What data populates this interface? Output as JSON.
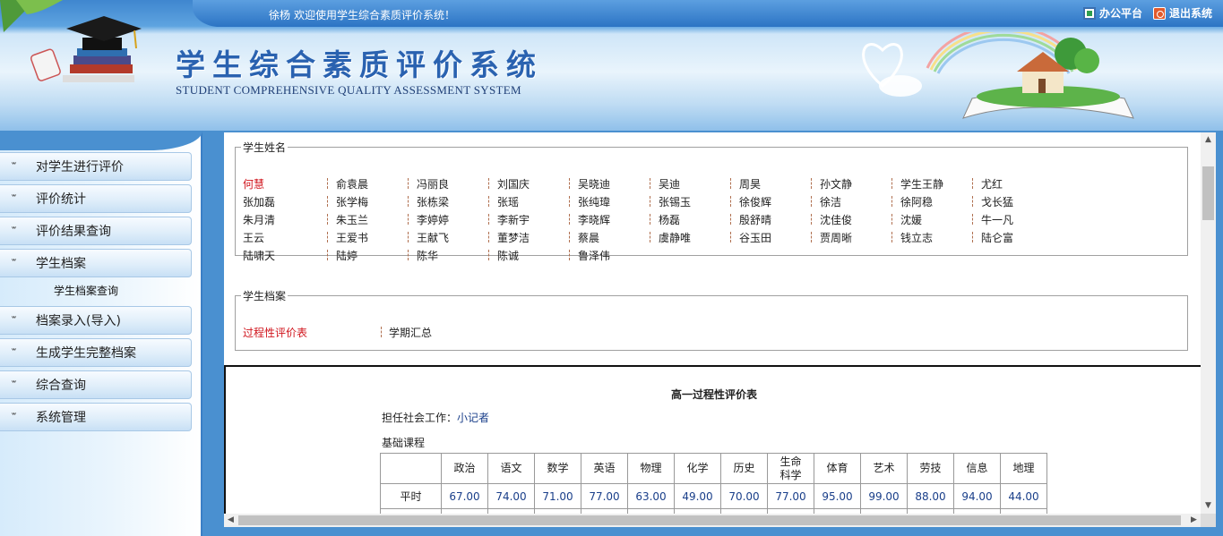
{
  "header": {
    "welcome_user": "徐杨",
    "welcome_text": "欢迎使用学生综合素质评价系统！",
    "office_link": "办公平台",
    "logout_link": "退出系统",
    "title": "学生综合素质评价系统",
    "subtitle": "STUDENT COMPREHENSIVE QUALITY ASSESSMENT SYSTEM"
  },
  "sidebar": {
    "items": [
      {
        "label": "对学生进行评价"
      },
      {
        "label": "评价统计"
      },
      {
        "label": "评价结果查询"
      },
      {
        "label": "学生档案"
      },
      {
        "label": "档案录入(导入)"
      },
      {
        "label": "生成学生完整档案"
      },
      {
        "label": "综合查询"
      },
      {
        "label": "系统管理"
      }
    ],
    "submenu": "学生档案查询"
  },
  "students": {
    "legend": "学生姓名",
    "rows": [
      [
        "何慧",
        "俞袁晨",
        "冯丽良",
        "刘国庆",
        "吴晓迪",
        "吴迪",
        "周昊",
        "孙文静",
        "学生王静",
        "尤红"
      ],
      [
        "张加磊",
        "张学梅",
        "张栋梁",
        "张瑶",
        "张纯瑋",
        "张锡玉",
        "徐俊辉",
        "徐洁",
        "徐阿稳",
        "戈长猛"
      ],
      [
        "朱月清",
        "朱玉兰",
        "李婷婷",
        "李新宇",
        "李晓辉",
        "杨磊",
        "殷舒晴",
        "沈佳俊",
        "沈媛",
        "牛一凡"
      ],
      [
        "王云",
        "王爱书",
        "王献飞",
        "董梦洁",
        "蔡晨",
        "虞静唯",
        "谷玉田",
        "贾周晰",
        "钱立志",
        "陆仑富"
      ],
      [
        "陆啸天",
        "陆婷",
        "陈华",
        "陈诚",
        "鲁泽伟"
      ]
    ],
    "selected": "何慧"
  },
  "archive": {
    "legend": "学生档案",
    "links": [
      "过程性评价表",
      "学期汇总"
    ],
    "selected": "过程性评价表"
  },
  "evaluation": {
    "title": "高一过程性评价表",
    "social_label": "担任社会工作：",
    "social_value": "小记者",
    "basic_label": "基础课程",
    "subjects": [
      "政治",
      "语文",
      "数学",
      "英语",
      "物理",
      "化学",
      "历史",
      "生命\n科学",
      "体育",
      "艺术",
      "劳技",
      "信息",
      "地理"
    ],
    "rows": [
      {
        "label": "平时",
        "values": [
          "67.00",
          "74.00",
          "71.00",
          "77.00",
          "63.00",
          "49.00",
          "70.00",
          "77.00",
          "95.00",
          "99.00",
          "88.00",
          "94.00",
          "44.00"
        ]
      }
    ]
  }
}
